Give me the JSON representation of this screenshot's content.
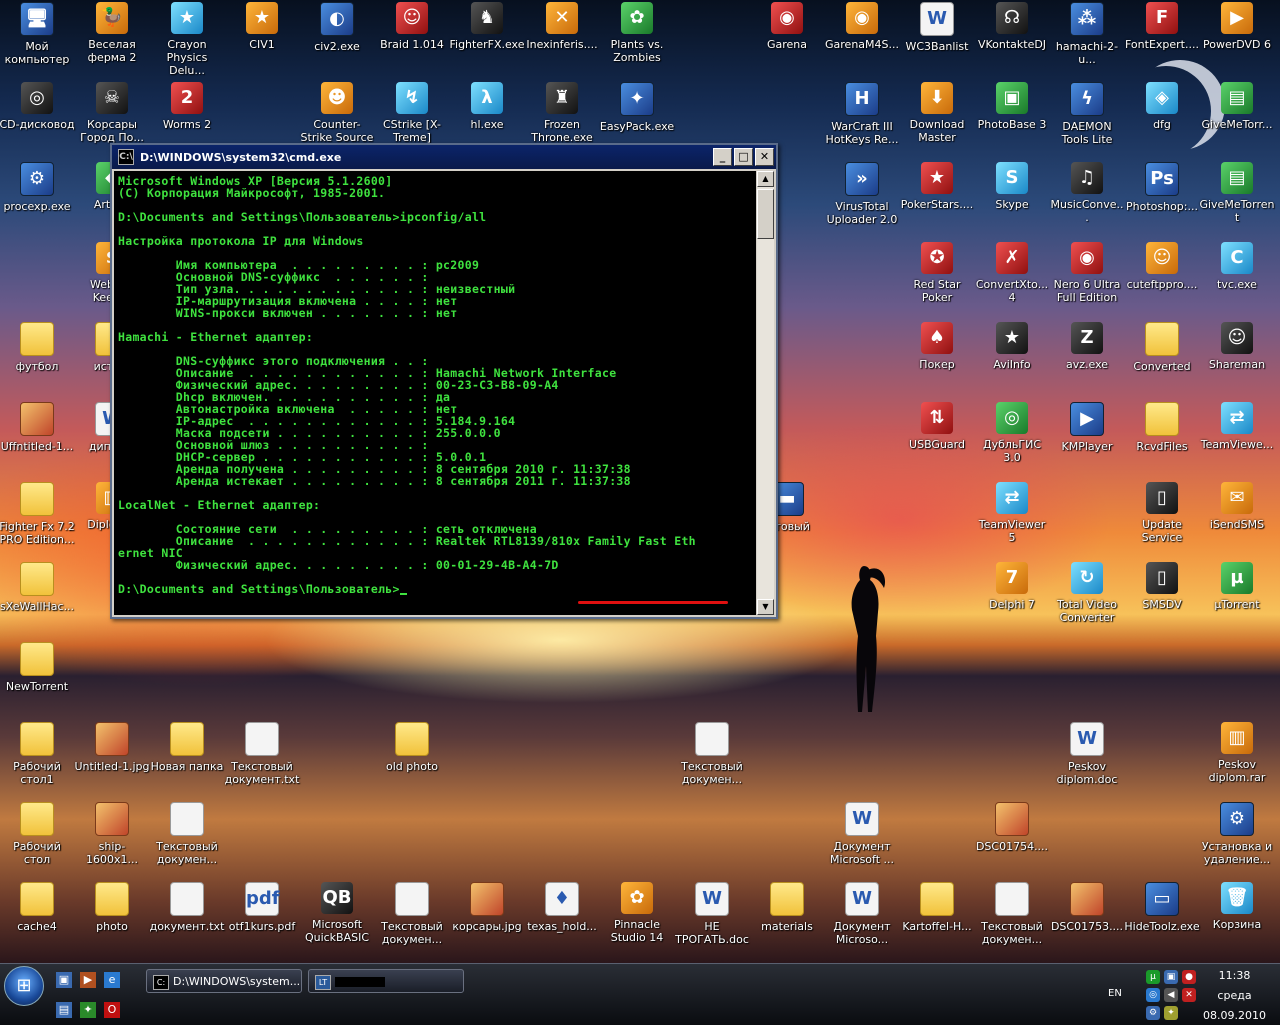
{
  "desktop": {
    "icons": [
      {
        "label": "Мой компьютер",
        "kind": "app",
        "glyph": "🖥"
      },
      {
        "label": "Веселая ферма 2",
        "kind": "orange",
        "glyph": "🦆"
      },
      {
        "label": "Crayon Physics Delu...",
        "kind": "cyan",
        "glyph": "★"
      },
      {
        "label": "CIV1",
        "kind": "orange",
        "glyph": "★"
      },
      {
        "label": "civ2.exe",
        "kind": "app",
        "glyph": "◐"
      },
      {
        "label": "Braid 1.014",
        "kind": "red",
        "glyph": "☺"
      },
      {
        "label": "FighterFX.exe",
        "kind": "dark",
        "glyph": "♞"
      },
      {
        "label": "Inexinferis....",
        "kind": "orange",
        "glyph": "✕"
      },
      {
        "label": "Plants vs. Zombies",
        "kind": "green",
        "glyph": "✿"
      },
      {
        "label": "Garena",
        "kind": "red",
        "glyph": "◉"
      },
      {
        "label": "GarenaM4S...",
        "kind": "orange",
        "glyph": "◉"
      },
      {
        "label": "WC3Banlist",
        "kind": "doc",
        "glyph": "W"
      },
      {
        "label": "VKontakteDJ",
        "kind": "dark",
        "glyph": "☊"
      },
      {
        "label": "hamachi-2-u...",
        "kind": "app",
        "glyph": "⁂"
      },
      {
        "label": "FontExpert....",
        "kind": "red",
        "glyph": "F"
      },
      {
        "label": "PowerDVD 6",
        "kind": "orange",
        "glyph": "▶"
      },
      {
        "label": "CD-дисковод",
        "kind": "dark",
        "glyph": "◎"
      },
      {
        "label": "Корсары Город По...",
        "kind": "dark",
        "glyph": "☠"
      },
      {
        "label": "Worms 2",
        "kind": "red",
        "glyph": "2"
      },
      {
        "label": "Counter-Strike Source",
        "kind": "orange",
        "glyph": "☻"
      },
      {
        "label": "CStrike [X-Treme]",
        "kind": "cyan",
        "glyph": "↯"
      },
      {
        "label": "hl.exe",
        "kind": "cyan",
        "glyph": "λ"
      },
      {
        "label": "Frozen Throne.exe",
        "kind": "dark",
        "glyph": "♜"
      },
      {
        "label": "EasyPack.exe",
        "kind": "app",
        "glyph": "✦"
      },
      {
        "label": "WarCraft III HotKeys Re...",
        "kind": "app",
        "glyph": "H"
      },
      {
        "label": "Download Master",
        "kind": "orange",
        "glyph": "⬇"
      },
      {
        "label": "PhotoBase 3",
        "kind": "green",
        "glyph": "▣"
      },
      {
        "label": "DAEMON Tools Lite",
        "kind": "app",
        "glyph": "ϟ"
      },
      {
        "label": "dfg",
        "kind": "cyan",
        "glyph": "◈"
      },
      {
        "label": "GiveMeTorr...",
        "kind": "green",
        "glyph": "▤"
      },
      {
        "label": "procexp.exe",
        "kind": "app",
        "glyph": "⚙"
      },
      {
        "label": "ArtM...",
        "kind": "green",
        "glyph": "◆"
      },
      {
        "label": "VirusTotal Uploader 2.0",
        "kind": "app",
        "glyph": "»"
      },
      {
        "label": "PokerStars....",
        "kind": "red",
        "glyph": "★"
      },
      {
        "label": "Skype",
        "kind": "cyan",
        "glyph": "S"
      },
      {
        "label": "MusicConve...",
        "kind": "dark",
        "glyph": "♫"
      },
      {
        "label": "Photoshop:...",
        "kind": "app",
        "glyph": "Ps"
      },
      {
        "label": "GiveMeTorrent",
        "kind": "green",
        "glyph": "▤"
      },
      {
        "label": "WebM... Keeper",
        "kind": "orange",
        "glyph": "$"
      },
      {
        "label": "Red Star Poker",
        "kind": "red",
        "glyph": "✪"
      },
      {
        "label": "ConvertXto... 4",
        "kind": "red",
        "glyph": "✗"
      },
      {
        "label": "Nero 6 Ultra Full Edition",
        "kind": "red",
        "glyph": "◉"
      },
      {
        "label": "cuteftppro....",
        "kind": "orange",
        "glyph": "☺"
      },
      {
        "label": "tvc.exe",
        "kind": "cyan",
        "glyph": "C"
      },
      {
        "label": "футбол",
        "kind": "folder",
        "glyph": ""
      },
      {
        "label": "исто...",
        "kind": "folder",
        "glyph": ""
      },
      {
        "label": "Покер",
        "kind": "red",
        "glyph": "♠"
      },
      {
        "label": "AviInfo",
        "kind": "dark",
        "glyph": "★"
      },
      {
        "label": "avz.exe",
        "kind": "dark",
        "glyph": "Z"
      },
      {
        "label": "Converted",
        "kind": "folder",
        "glyph": ""
      },
      {
        "label": "Shareman",
        "kind": "dark",
        "glyph": "☺"
      },
      {
        "label": "Uffntitled-1...",
        "kind": "img",
        "glyph": ""
      },
      {
        "label": "дипло...",
        "kind": "doc",
        "glyph": "W"
      },
      {
        "label": "USBGuard",
        "kind": "red",
        "glyph": "⇅"
      },
      {
        "label": "ДубльГИС 3.0",
        "kind": "green",
        "glyph": "◎"
      },
      {
        "label": "KMPlayer",
        "kind": "app",
        "glyph": "▶"
      },
      {
        "label": "RcvdFiles",
        "kind": "folder",
        "glyph": ""
      },
      {
        "label": "TeamViewe...",
        "kind": "cyan",
        "glyph": "⇄"
      },
      {
        "label": "Fighter Fx 7.2 PRO Edition...",
        "kind": "folder",
        "glyph": ""
      },
      {
        "label": "Diplom...",
        "kind": "orange",
        "glyph": "▥"
      },
      {
        "label": "...товый",
        "kind": "app",
        "glyph": "▬"
      },
      {
        "label": "TeamViewer 5",
        "kind": "cyan",
        "glyph": "⇄"
      },
      {
        "label": "Update Service",
        "kind": "dark",
        "glyph": "▯"
      },
      {
        "label": "iSendSMS",
        "kind": "orange",
        "glyph": "✉"
      },
      {
        "label": "sXeWallHac...",
        "kind": "folder",
        "glyph": ""
      },
      {
        "label": "Delphi 7",
        "kind": "orange",
        "glyph": "7"
      },
      {
        "label": "Total Video Converter",
        "kind": "cyan",
        "glyph": "↻"
      },
      {
        "label": "SMSDV",
        "kind": "dark",
        "glyph": "▯"
      },
      {
        "label": "µTorrent",
        "kind": "green",
        "glyph": "µ"
      },
      {
        "label": "NewTorrent",
        "kind": "folder",
        "glyph": ""
      },
      {
        "label": "Рабочий стол1",
        "kind": "folder",
        "glyph": ""
      },
      {
        "label": "Untitled-1.jpg",
        "kind": "img",
        "glyph": ""
      },
      {
        "label": "Новая папка",
        "kind": "folder",
        "glyph": ""
      },
      {
        "label": "Текстовый документ.txt",
        "kind": "doc",
        "glyph": ""
      },
      {
        "label": "old photo",
        "kind": "folder",
        "glyph": ""
      },
      {
        "label": "Текстовый докумен...",
        "kind": "doc",
        "glyph": ""
      },
      {
        "label": "Peskov diplom.doc",
        "kind": "doc",
        "glyph": "W"
      },
      {
        "label": "Peskov diplom.rar",
        "kind": "orange",
        "glyph": "▥"
      },
      {
        "label": "Рабочий стол",
        "kind": "folder",
        "glyph": ""
      },
      {
        "label": "ship-1600x1...",
        "kind": "img",
        "glyph": ""
      },
      {
        "label": "Текстовый докумен...",
        "kind": "doc",
        "glyph": ""
      },
      {
        "label": "Документ Microsoft ...",
        "kind": "doc",
        "glyph": "W"
      },
      {
        "label": "DSC01754....",
        "kind": "img",
        "glyph": ""
      },
      {
        "label": "Установка и удаление...",
        "kind": "app",
        "glyph": "⚙"
      },
      {
        "label": "cache4",
        "kind": "folder",
        "glyph": ""
      },
      {
        "label": "photo",
        "kind": "folder",
        "glyph": ""
      },
      {
        "label": "документ.txt",
        "kind": "doc",
        "glyph": ""
      },
      {
        "label": "otf1kurs.pdf",
        "kind": "doc",
        "glyph": "pdf"
      },
      {
        "label": "Microsoft QuickBASIC",
        "kind": "dark",
        "glyph": "QB"
      },
      {
        "label": "Текстовый докумен...",
        "kind": "doc",
        "glyph": ""
      },
      {
        "label": "корсары.jpg",
        "kind": "img",
        "glyph": ""
      },
      {
        "label": "texas_hold...",
        "kind": "doc",
        "glyph": "♦"
      },
      {
        "label": "Pinnacle Studio 14",
        "kind": "orange",
        "glyph": "✿"
      },
      {
        "label": "НЕ ТРОГАТЬ.doc",
        "kind": "doc",
        "glyph": "W"
      },
      {
        "label": "materials",
        "kind": "folder",
        "glyph": ""
      },
      {
        "label": "Документ Microso...",
        "kind": "doc",
        "glyph": "W"
      },
      {
        "label": "Kartoffel-H...",
        "kind": "folder",
        "glyph": ""
      },
      {
        "label": "Текстовый докумен...",
        "kind": "doc",
        "glyph": ""
      },
      {
        "label": "DSC01753....",
        "kind": "img",
        "glyph": ""
      },
      {
        "label": "HideToolz.exe",
        "kind": "app",
        "glyph": "▭"
      },
      {
        "label": "Корзина",
        "kind": "cyan",
        "glyph": "🗑"
      }
    ]
  },
  "cmd": {
    "title": "D:\\WINDOWS\\system32\\cmd.exe",
    "lines": [
      "Microsoft Windows XP [Версия 5.1.2600]",
      "(C) Корпорация Майкрософт, 1985-2001.",
      "",
      "D:\\Documents and Settings\\Пользователь>ipconfig/all",
      "",
      "Настройка протокола IP для Windows",
      "",
      "        Имя компьютера  . . . . . . . . . : pc2009",
      "        Основной DNS-суффикс  . . . . . . :",
      "        Тип узла. . . . . . . . . . . . . : неизвестный",
      "        IP-маршрутизация включена . . . . : нет",
      "        WINS-прокси включен . . . . . . . : нет",
      "",
      "Hamachi - Ethernet адаптер:",
      "",
      "        DNS-суффикс этого подключения . . :",
      "        Описание  . . . . . . . . . . . . : Hamachi Network Interface",
      "        Физический адрес. . . . . . . . . : 00-23-C3-B8-09-A4",
      "        Dhcp включен. . . . . . . . . . . : да",
      "        Автонастройка включена  . . . . . : нет",
      "        IP-адрес  . . . . . . . . . . . . : 5.184.9.164",
      "        Маска подсети . . . . . . . . . . : 255.0.0.0",
      "        Основной шлюз . . . . . . . . . . :",
      "        DHCP-сервер . . . . . . . . . . . : 5.0.0.1",
      "        Аренда получена . . . . . . . . . : 8 сентября 2010 г. 11:37:38",
      "        Аренда истекает . . . . . . . . . : 8 сентября 2011 г. 11:37:38",
      "",
      "LocalNet - Ethernet адаптер:",
      "",
      "        Состояние сети  . . . . . . . . . : сеть отключена",
      "        Описание  . . . . . . . . . . . . : Realtek RTL8139/810x Family Fast Eth",
      "ernet NIC",
      "        Физический адрес. . . . . . . . . : 00-01-29-4B-A4-7D",
      "",
      "D:\\Documents and Settings\\Пользователь>"
    ]
  },
  "taskbar": {
    "start_glyph": "⊞",
    "quick_launch": [
      {
        "name": "show-desktop-icon",
        "glyph": "▣",
        "color": "#3a6ab0"
      },
      {
        "name": "media-icon",
        "glyph": "▶",
        "color": "#b05020"
      },
      {
        "name": "ie-icon",
        "glyph": "e",
        "color": "#2a7ad0"
      },
      {
        "name": "explorer-icon",
        "glyph": "▤",
        "color": "#3a6ab0"
      },
      {
        "name": "windows-icon",
        "glyph": "✦",
        "color": "#2a8a2a"
      },
      {
        "name": "opera-icon",
        "glyph": "O",
        "color": "#c01010"
      }
    ],
    "task_cmd": "D:\\WINDOWS\\system...",
    "task_other": "LT",
    "lang": "EN",
    "time": "11:38",
    "day": "среда",
    "date": "08.09.2010"
  }
}
